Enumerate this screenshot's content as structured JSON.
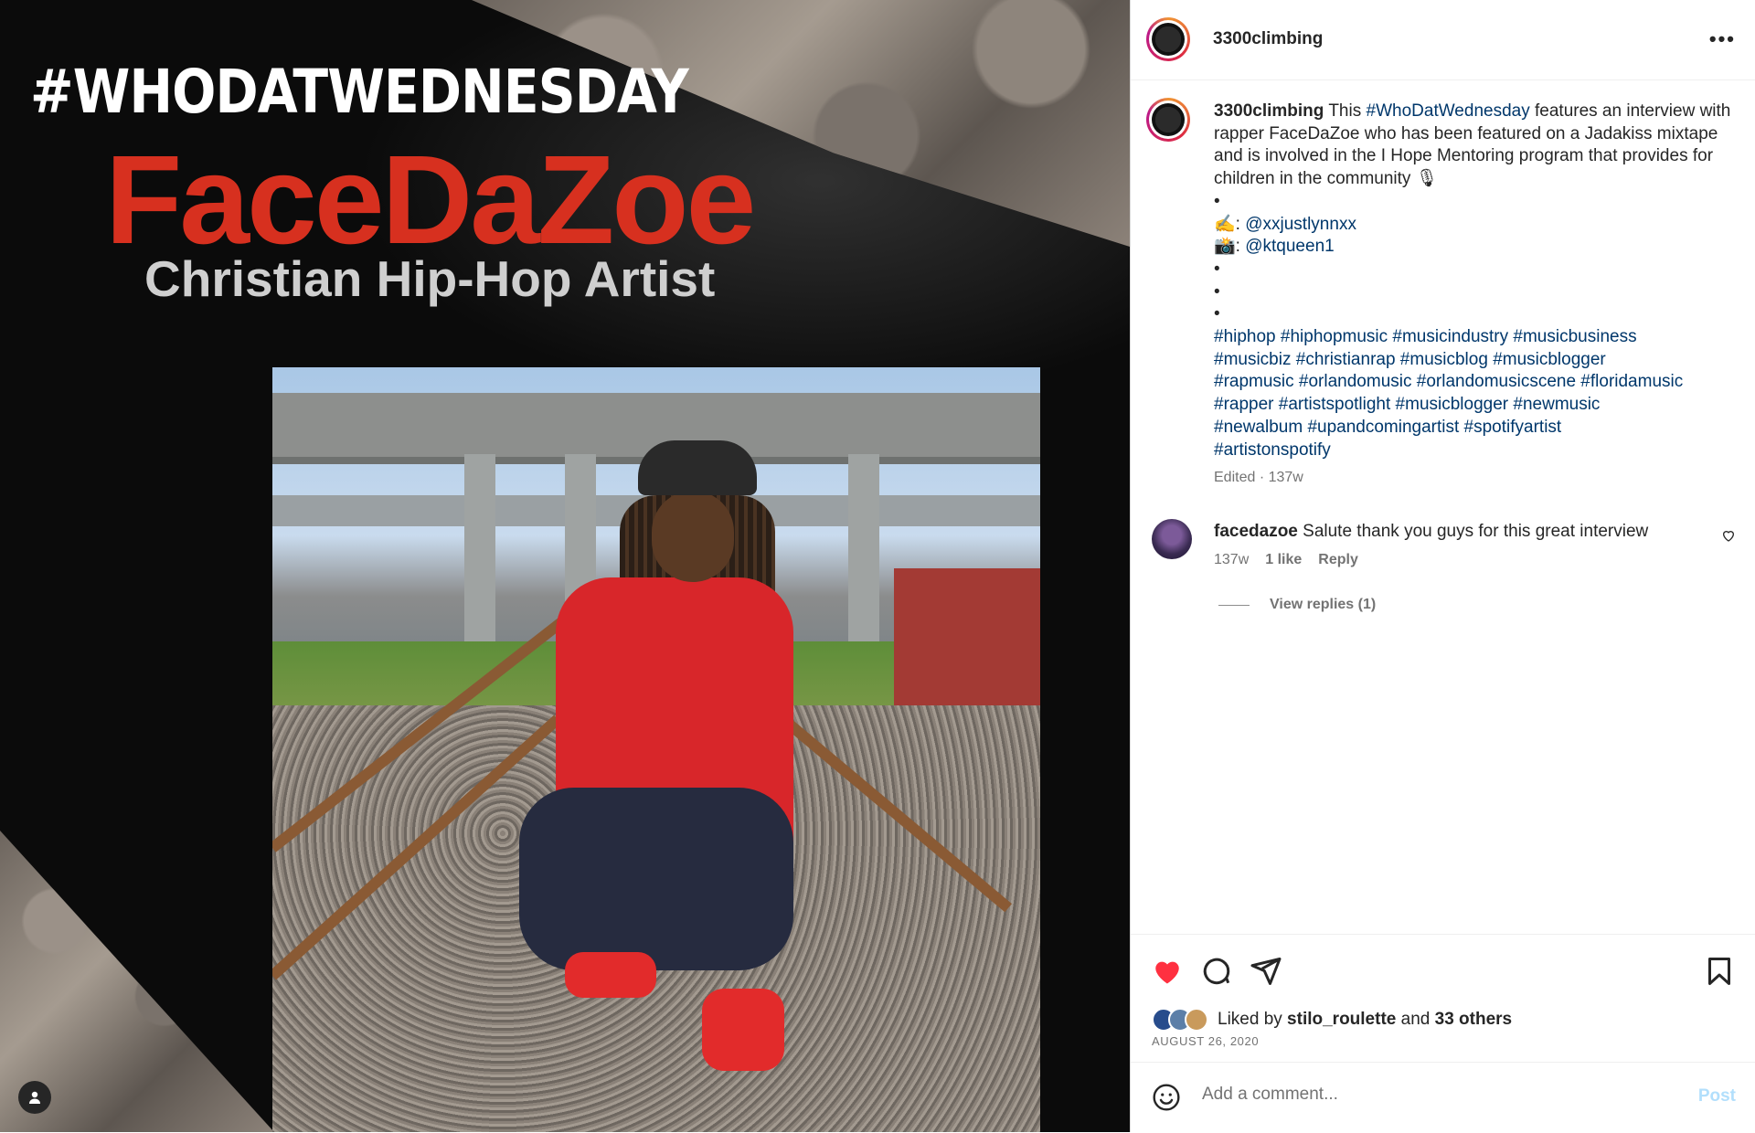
{
  "media": {
    "hashtag_title": "#WHODATWEDNESDAY",
    "artist_name": "FaceDaZoe",
    "artist_subtitle": "Christian Hip-Hop Artist",
    "user_tag_icon": "person-icon"
  },
  "header": {
    "username": "3300climbing",
    "more_icon": "more-options-icon",
    "more_label": "•••"
  },
  "caption": {
    "username": "3300climbing",
    "text_before": "This ",
    "hashtag_inline": "#WhoDatWednesday",
    "text_after": " features an interview with rapper FaceDaZoe who has been featured on a Jadakiss mixtape and is involved in the I Hope Mentoring program that provides for children in the community 🎙",
    "dot1": "•",
    "credit_writer_emoji": "✍️",
    "credit_writer_handle": "@xxjustlynnxx",
    "credit_photo_emoji": "📸",
    "credit_photo_handle": "@ktqueen1",
    "dot2": "•",
    "dot3": "•",
    "dot4": "•",
    "hashtags_line1": "#hiphop #hiphopmusic #musicindustry #musicbusiness",
    "hashtags_line2": "#musicbiz #christianrap #musicblog #musicblogger",
    "hashtags_line3": "#rapmusic #orlandomusic #orlandomusicscene #floridamusic",
    "hashtags_line4": "#rapper #artistspotlight #musicblogger #newmusic",
    "hashtags_line5": "#newalbum #upandcomingartist #spotifyartist",
    "hashtags_line6": "#artistonspotify",
    "edited_label": "Edited · 137w"
  },
  "comment": {
    "username": "facedazoe",
    "text": "Salute thank you guys for this great interview",
    "age": "137w",
    "likes": "1 like",
    "reply_label": "Reply",
    "view_replies": "View replies (1)"
  },
  "actions": {
    "like_icon": "heart-filled-icon",
    "comment_icon": "comment-icon",
    "share_icon": "send-icon",
    "save_icon": "bookmark-icon",
    "liked_by_prefix": "Liked by ",
    "liked_by_user": "stilo_roulette",
    "liked_by_and": " and ",
    "liked_by_others": "33 others",
    "date": "AUGUST 26, 2020"
  },
  "comment_box": {
    "emoji_icon": "emoji-icon",
    "placeholder": "Add a comment...",
    "post_label": "Post"
  },
  "colors": {
    "accent_red": "#d7301f",
    "like_red": "#ff3040",
    "link_blue": "#00376b",
    "post_blue_disabled": "#b2dffc"
  }
}
